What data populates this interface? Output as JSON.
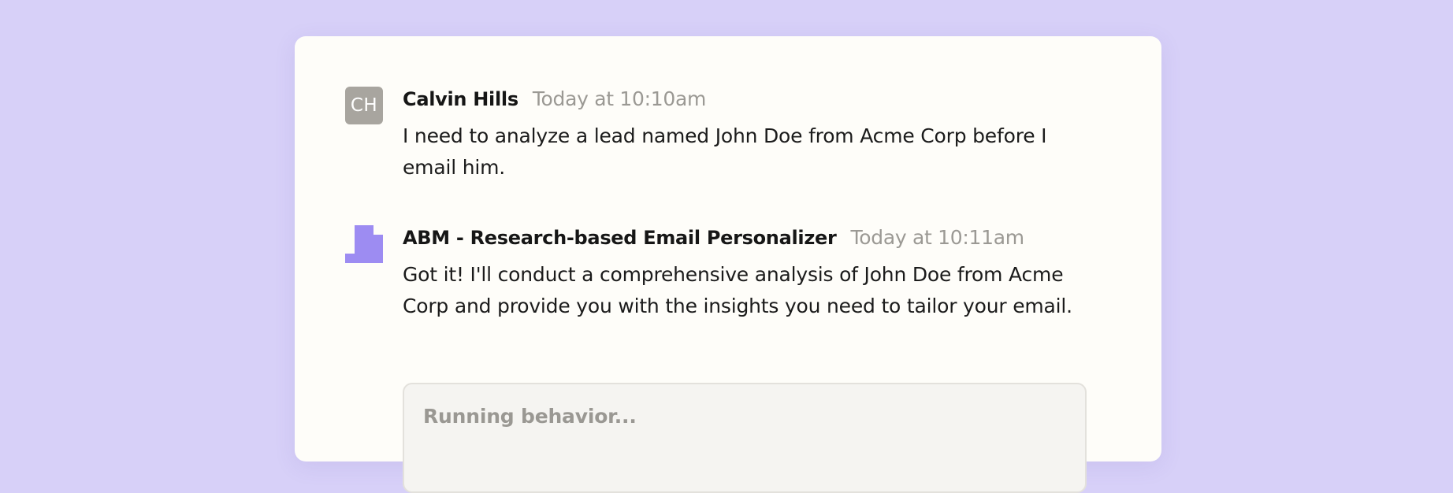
{
  "messages": [
    {
      "avatar_initials": "CH",
      "avatar_color": "#a8a59f",
      "author": "Calvin Hills",
      "timestamp": "Today at 10:10am",
      "text": "I need to analyze a lead named John Doe from Acme Corp before I email him."
    },
    {
      "avatar_icon": "agent-logo-icon",
      "avatar_color": "#9d8cf2",
      "author": "ABM - Research-based Email Personalizer",
      "timestamp": "Today at 10:11am",
      "text": "Got it! I'll conduct a comprehensive analysis of John Doe from Acme Corp and provide you with the insights you need to tailor your email."
    }
  ],
  "behavior": {
    "status_label": "Running behavior..."
  },
  "colors": {
    "page_background": "#d7d0f8",
    "card_background": "#fefdf9",
    "accent": "#9d8cf2"
  }
}
